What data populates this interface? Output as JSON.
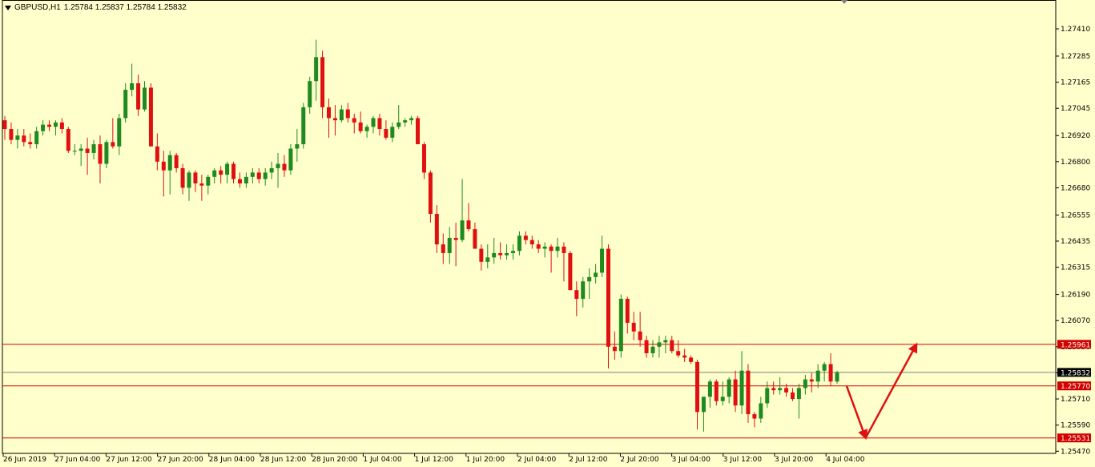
{
  "window": {
    "symbol": "GBPUSD,H1",
    "ohlc": "1.25784 1.25837 1.25784 1.25832"
  },
  "colors": {
    "background": "#ffffcc",
    "bull": "#1f8a1f",
    "bear": "#e01010",
    "level_line": "#d40000",
    "bid_line": "#7f7f7f",
    "arrow": "#e01010"
  },
  "chart_data": {
    "type": "candlestick",
    "symbol": "GBPUSD",
    "timeframe": "H1",
    "y_ticks": [
      "1.27410",
      "1.27285",
      "1.27165",
      "1.27045",
      "1.26920",
      "1.26800",
      "1.26680",
      "1.26555",
      "1.26435",
      "1.26315",
      "1.26190",
      "1.26070",
      "1.25950",
      "1.25830",
      "1.25710",
      "1.25590",
      "1.25470"
    ],
    "ylim": [
      1.2546,
      1.2748
    ],
    "x_labels": [
      "26 Jun 2019",
      "27 Jun 04:00",
      "27 Jun 12:00",
      "27 Jun 20:00",
      "28 Jun 04:00",
      "28 Jun 12:00",
      "28 Jun 20:00",
      "1 Jul 04:00",
      "1 Jul 12:00",
      "1 Jul 20:00",
      "2 Jul 04:00",
      "2 Jul 12:00",
      "2 Jul 20:00",
      "3 Jul 04:00",
      "3 Jul 12:00",
      "3 Jul 20:00",
      "4 Jul 04:00"
    ],
    "horizontal_levels": [
      {
        "price": 1.25961,
        "label": "1.25961"
      },
      {
        "price": 1.2577,
        "label": "1.25770"
      },
      {
        "price": 1.25531,
        "label": "1.25531"
      }
    ],
    "bid": {
      "price": 1.25832,
      "label": "1.25832"
    },
    "forecast_arrows": [
      {
        "from": {
          "time": "4 Jul 05:00",
          "price": 1.2577
        },
        "to": {
          "time": "4 Jul 08:00",
          "price": 1.25531
        }
      },
      {
        "from": {
          "time": "4 Jul 08:00",
          "price": 1.25531
        },
        "to": {
          "time": "4 Jul 16:00",
          "price": 1.25961
        }
      }
    ],
    "candles": [
      [
        1.2699,
        1.2701,
        1.269,
        1.2695
      ],
      [
        1.2695,
        1.2698,
        1.2688,
        1.269
      ],
      [
        1.269,
        1.2695,
        1.2686,
        1.2692
      ],
      [
        1.2692,
        1.2695,
        1.2687,
        1.2689
      ],
      [
        1.2689,
        1.2693,
        1.2686,
        1.2688
      ],
      [
        1.2688,
        1.2696,
        1.2686,
        1.2694
      ],
      [
        1.2694,
        1.2699,
        1.2692,
        1.2697
      ],
      [
        1.2697,
        1.2699,
        1.2694,
        1.2696
      ],
      [
        1.2696,
        1.2699,
        1.2692,
        1.2698
      ],
      [
        1.2698,
        1.27,
        1.2693,
        1.2695
      ],
      [
        1.2695,
        1.2696,
        1.2684,
        1.2685
      ],
      [
        1.2685,
        1.2688,
        1.2683,
        1.2685
      ],
      [
        1.2685,
        1.2688,
        1.2678,
        1.2686
      ],
      [
        1.2686,
        1.2691,
        1.2674,
        1.2684
      ],
      [
        1.2684,
        1.269,
        1.2681,
        1.2688
      ],
      [
        1.2688,
        1.2692,
        1.267,
        1.2679
      ],
      [
        1.2679,
        1.269,
        1.2677,
        1.2689
      ],
      [
        1.2689,
        1.27,
        1.2686,
        1.2687
      ],
      [
        1.2687,
        1.2702,
        1.2683,
        1.27
      ],
      [
        1.27,
        1.2716,
        1.2698,
        1.2713
      ],
      [
        1.2713,
        1.2725,
        1.271,
        1.2716
      ],
      [
        1.2716,
        1.272,
        1.2701,
        1.2704
      ],
      [
        1.2704,
        1.2717,
        1.2703,
        1.2714
      ],
      [
        1.2714,
        1.2716,
        1.2692,
        1.2687
      ],
      [
        1.2687,
        1.2693,
        1.2676,
        1.268
      ],
      [
        1.268,
        1.2685,
        1.2664,
        1.2676
      ],
      [
        1.2676,
        1.2685,
        1.2665,
        1.2683
      ],
      [
        1.2683,
        1.2684,
        1.2675,
        1.2677
      ],
      [
        1.2677,
        1.2679,
        1.2665,
        1.2668
      ],
      [
        1.2668,
        1.2676,
        1.2662,
        1.2675
      ],
      [
        1.2675,
        1.2676,
        1.2666,
        1.267
      ],
      [
        1.267,
        1.2674,
        1.2662,
        1.2669
      ],
      [
        1.2669,
        1.2674,
        1.2665,
        1.2673
      ],
      [
        1.2673,
        1.2677,
        1.267,
        1.2676
      ],
      [
        1.2676,
        1.2678,
        1.267,
        1.2674
      ],
      [
        1.2674,
        1.268,
        1.267,
        1.2679
      ],
      [
        1.2679,
        1.268,
        1.267,
        1.2672
      ],
      [
        1.2672,
        1.2675,
        1.2668,
        1.267
      ],
      [
        1.267,
        1.2675,
        1.2668,
        1.2673
      ],
      [
        1.2673,
        1.2677,
        1.267,
        1.2675
      ],
      [
        1.2675,
        1.2677,
        1.267,
        1.2672
      ],
      [
        1.2672,
        1.2677,
        1.2669,
        1.2675
      ],
      [
        1.2675,
        1.268,
        1.2672,
        1.2677
      ],
      [
        1.2677,
        1.2684,
        1.2668,
        1.2679
      ],
      [
        1.2679,
        1.2683,
        1.2673,
        1.2676
      ],
      [
        1.2676,
        1.2688,
        1.2674,
        1.2686
      ],
      [
        1.2686,
        1.2695,
        1.268,
        1.2688
      ],
      [
        1.2688,
        1.2707,
        1.2686,
        1.2705
      ],
      [
        1.2705,
        1.2719,
        1.2702,
        1.2717
      ],
      [
        1.2717,
        1.2736,
        1.2708,
        1.2728
      ],
      [
        1.2728,
        1.2731,
        1.27,
        1.2705
      ],
      [
        1.2705,
        1.2709,
        1.2691,
        1.27
      ],
      [
        1.27,
        1.2706,
        1.2692,
        1.2699
      ],
      [
        1.2699,
        1.2706,
        1.2698,
        1.2704
      ],
      [
        1.2704,
        1.2707,
        1.2698,
        1.27
      ],
      [
        1.27,
        1.2702,
        1.2693,
        1.2698
      ],
      [
        1.2698,
        1.2703,
        1.2693,
        1.2694
      ],
      [
        1.2694,
        1.2697,
        1.2691,
        1.2696
      ],
      [
        1.2696,
        1.2701,
        1.2693,
        1.27
      ],
      [
        1.27,
        1.2702,
        1.2692,
        1.2695
      ],
      [
        1.2695,
        1.2699,
        1.269,
        1.2691
      ],
      [
        1.2691,
        1.2698,
        1.2689,
        1.2696
      ],
      [
        1.2696,
        1.2706,
        1.2695,
        1.2698
      ],
      [
        1.2698,
        1.27,
        1.2696,
        1.2699
      ],
      [
        1.2699,
        1.2701,
        1.2697,
        1.27
      ],
      [
        1.27,
        1.2701,
        1.2693,
        1.2688
      ],
      [
        1.2688,
        1.2689,
        1.2672,
        1.2675
      ],
      [
        1.2675,
        1.2676,
        1.2652,
        1.2656
      ],
      [
        1.2656,
        1.266,
        1.2638,
        1.2642
      ],
      [
        1.2642,
        1.2647,
        1.2633,
        1.2638
      ],
      [
        1.2638,
        1.265,
        1.2633,
        1.2645
      ],
      [
        1.2645,
        1.2652,
        1.2632,
        1.2644
      ],
      [
        1.2644,
        1.2672,
        1.2643,
        1.2653
      ],
      [
        1.2653,
        1.2661,
        1.2648,
        1.2649
      ],
      [
        1.2649,
        1.2652,
        1.2641,
        1.264
      ],
      [
        1.264,
        1.2642,
        1.263,
        1.2634
      ],
      [
        1.2634,
        1.2642,
        1.2631,
        1.2636
      ],
      [
        1.2636,
        1.2645,
        1.2633,
        1.2638
      ],
      [
        1.2638,
        1.2643,
        1.2635,
        1.2637
      ],
      [
        1.2637,
        1.2642,
        1.2635,
        1.2638
      ],
      [
        1.2638,
        1.2642,
        1.2635,
        1.2639
      ],
      [
        1.2639,
        1.2648,
        1.2637,
        1.2646
      ],
      [
        1.2646,
        1.2648,
        1.2642,
        1.2644
      ],
      [
        1.2644,
        1.2646,
        1.264,
        1.2642
      ],
      [
        1.2642,
        1.2644,
        1.2638,
        1.264
      ],
      [
        1.264,
        1.2643,
        1.2636,
        1.2641
      ],
      [
        1.2641,
        1.2642,
        1.2629,
        1.2639
      ],
      [
        1.2639,
        1.2645,
        1.2636,
        1.2641
      ],
      [
        1.2641,
        1.2643,
        1.2625,
        1.2638
      ],
      [
        1.2638,
        1.2639,
        1.2621,
        1.2621
      ],
      [
        1.2621,
        1.2625,
        1.2609,
        1.2617
      ],
      [
        1.2617,
        1.2627,
        1.2613,
        1.2625
      ],
      [
        1.2625,
        1.2631,
        1.2617,
        1.2627
      ],
      [
        1.2627,
        1.2633,
        1.2624,
        1.2629
      ],
      [
        1.2629,
        1.2646,
        1.2627,
        1.264
      ],
      [
        1.264,
        1.2642,
        1.2585,
        1.2595
      ],
      [
        1.2595,
        1.2602,
        1.2589,
        1.2593
      ],
      [
        1.2593,
        1.2619,
        1.259,
        1.2617
      ],
      [
        1.2617,
        1.2618,
        1.2601,
        1.2606
      ],
      [
        1.2606,
        1.2611,
        1.2598,
        1.2602
      ],
      [
        1.2602,
        1.2611,
        1.2595,
        1.2598
      ],
      [
        1.2598,
        1.26,
        1.259,
        1.2592
      ],
      [
        1.2592,
        1.2598,
        1.259,
        1.2595
      ],
      [
        1.2595,
        1.26,
        1.259,
        1.2597
      ],
      [
        1.2597,
        1.26,
        1.2592,
        1.2598
      ],
      [
        1.2598,
        1.26,
        1.2592,
        1.2593
      ],
      [
        1.2593,
        1.2598,
        1.259,
        1.2591
      ],
      [
        1.2591,
        1.2594,
        1.2588,
        1.259
      ],
      [
        1.259,
        1.2591,
        1.2587,
        1.2588
      ],
      [
        1.2588,
        1.2589,
        1.2557,
        1.2565
      ],
      [
        1.2565,
        1.2572,
        1.2556,
        1.2572
      ],
      [
        1.2572,
        1.258,
        1.2567,
        1.2579
      ],
      [
        1.2579,
        1.258,
        1.2568,
        1.257
      ],
      [
        1.257,
        1.2579,
        1.2568,
        1.2572
      ],
      [
        1.2572,
        1.2581,
        1.2569,
        1.258
      ],
      [
        1.258,
        1.2584,
        1.2565,
        1.2568
      ],
      [
        1.2568,
        1.2593,
        1.2564,
        1.2584
      ],
      [
        1.2584,
        1.2587,
        1.256,
        1.2564
      ],
      [
        1.2564,
        1.2565,
        1.2558,
        1.2562
      ],
      [
        1.2562,
        1.2572,
        1.256,
        1.2569
      ],
      [
        1.2569,
        1.2579,
        1.2567,
        1.2576
      ],
      [
        1.2576,
        1.2579,
        1.2573,
        1.2575
      ],
      [
        1.2575,
        1.2581,
        1.2573,
        1.2576
      ],
      [
        1.2576,
        1.2578,
        1.2572,
        1.2574
      ],
      [
        1.2574,
        1.2576,
        1.257,
        1.2571
      ],
      [
        1.2571,
        1.2578,
        1.2562,
        1.2576
      ],
      [
        1.2576,
        1.2582,
        1.2573,
        1.258
      ],
      [
        1.258,
        1.2583,
        1.2574,
        1.2579
      ],
      [
        1.2579,
        1.2587,
        1.2576,
        1.2584
      ],
      [
        1.2584,
        1.2588,
        1.2579,
        1.2587
      ],
      [
        1.2587,
        1.2592,
        1.2577,
        1.2579
      ],
      [
        1.2579,
        1.2584,
        1.2578,
        1.25832
      ]
    ]
  }
}
